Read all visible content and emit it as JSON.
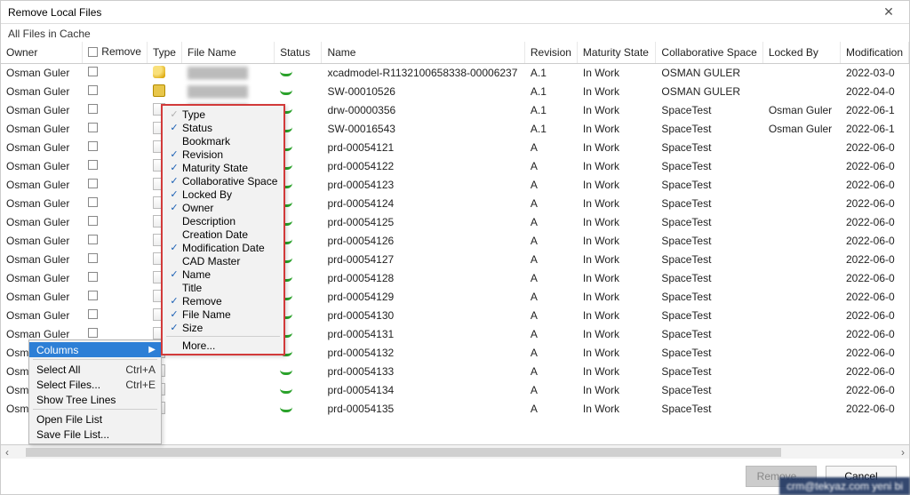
{
  "dialog": {
    "title": "Remove Local Files"
  },
  "subhead": "All Files in Cache",
  "columns": {
    "owner": "Owner",
    "remove": "Remove",
    "type": "Type",
    "filename": "File Name",
    "status": "Status",
    "name": "Name",
    "revision": "Revision",
    "maturity": "Maturity State",
    "collab": "Collaborative Space",
    "locked": "Locked By",
    "moddate": "Modification "
  },
  "rows": [
    {
      "owner": "Osman Guler",
      "type": "part",
      "filename": "████████",
      "name": "xcadmodel-R1132100658338-00006237",
      "rev": "A.1",
      "mat": "In Work",
      "collab": "OSMAN GULER",
      "locked": "",
      "mod": "2022-03-0"
    },
    {
      "owner": "Osman Guler",
      "type": "assy",
      "filename": "████████",
      "name": "SW-00010526",
      "rev": "A.1",
      "mat": "In Work",
      "collab": "OSMAN GULER",
      "locked": "",
      "mod": "2022-04-0"
    },
    {
      "owner": "Osman Guler",
      "type": "drw",
      "filename": "████████",
      "name": "drw-00000356",
      "rev": "A.1",
      "mat": "In Work",
      "collab": "SpaceTest",
      "locked": "Osman Guler",
      "mod": "2022-06-1"
    },
    {
      "owner": "Osman Guler",
      "type": "drw",
      "filename": "",
      "name": "SW-00016543",
      "rev": "A.1",
      "mat": "In Work",
      "collab": "SpaceTest",
      "locked": "Osman Guler",
      "mod": "2022-06-1"
    },
    {
      "owner": "Osman Guler",
      "type": "drw",
      "filename": "",
      "name": "prd-00054121",
      "rev": "A",
      "mat": "In Work",
      "collab": "SpaceTest",
      "locked": "",
      "mod": "2022-06-0"
    },
    {
      "owner": "Osman Guler",
      "type": "drw",
      "filename": "",
      "name": "prd-00054122",
      "rev": "A",
      "mat": "In Work",
      "collab": "SpaceTest",
      "locked": "",
      "mod": "2022-06-0"
    },
    {
      "owner": "Osman Guler",
      "type": "drw",
      "filename": "",
      "name": "prd-00054123",
      "rev": "A",
      "mat": "In Work",
      "collab": "SpaceTest",
      "locked": "",
      "mod": "2022-06-0"
    },
    {
      "owner": "Osman Guler",
      "type": "drw",
      "filename": "",
      "name": "prd-00054124",
      "rev": "A",
      "mat": "In Work",
      "collab": "SpaceTest",
      "locked": "",
      "mod": "2022-06-0"
    },
    {
      "owner": "Osman Guler",
      "type": "drw",
      "filename": "",
      "name": "prd-00054125",
      "rev": "A",
      "mat": "In Work",
      "collab": "SpaceTest",
      "locked": "",
      "mod": "2022-06-0"
    },
    {
      "owner": "Osman Guler",
      "type": "drw",
      "filename": "",
      "name": "prd-00054126",
      "rev": "A",
      "mat": "In Work",
      "collab": "SpaceTest",
      "locked": "",
      "mod": "2022-06-0"
    },
    {
      "owner": "Osman Guler",
      "type": "drw",
      "filename": "",
      "name": "prd-00054127",
      "rev": "A",
      "mat": "In Work",
      "collab": "SpaceTest",
      "locked": "",
      "mod": "2022-06-0"
    },
    {
      "owner": "Osman Guler",
      "type": "drw",
      "filename": "",
      "name": "prd-00054128",
      "rev": "A",
      "mat": "In Work",
      "collab": "SpaceTest",
      "locked": "",
      "mod": "2022-06-0"
    },
    {
      "owner": "Osman Guler",
      "type": "drw",
      "filename": "",
      "name": "prd-00054129",
      "rev": "A",
      "mat": "In Work",
      "collab": "SpaceTest",
      "locked": "",
      "mod": "2022-06-0"
    },
    {
      "owner": "Osman Guler",
      "type": "drw",
      "filename": "",
      "name": "prd-00054130",
      "rev": "A",
      "mat": "In Work",
      "collab": "SpaceTest",
      "locked": "",
      "mod": "2022-06-0"
    },
    {
      "owner": "Osman Guler",
      "type": "drw",
      "filename": "",
      "name": "prd-00054131",
      "rev": "A",
      "mat": "In Work",
      "collab": "SpaceTest",
      "locked": "",
      "mod": "2022-06-0"
    },
    {
      "owner": "Osman Guler",
      "type": "drw",
      "filename": "",
      "name": "prd-00054132",
      "rev": "A",
      "mat": "In Work",
      "collab": "SpaceTest",
      "locked": "",
      "mod": "2022-06-0"
    },
    {
      "owner": "Osman Guler",
      "type": "drw",
      "filename": "",
      "name": "prd-00054133",
      "rev": "A",
      "mat": "In Work",
      "collab": "SpaceTest",
      "locked": "",
      "mod": "2022-06-0"
    },
    {
      "owner": "Osman Guler",
      "type": "drw",
      "filename": "",
      "name": "prd-00054134",
      "rev": "A",
      "mat": "In Work",
      "collab": "SpaceTest",
      "locked": "",
      "mod": "2022-06-0"
    },
    {
      "owner": "Osman Guler",
      "type": "drw",
      "filename": "",
      "name": "prd-00054135",
      "rev": "A",
      "mat": "In Work",
      "collab": "SpaceTest",
      "locked": "",
      "mod": "2022-06-0"
    }
  ],
  "ctx": {
    "columns": "Columns",
    "selall": "Select All",
    "selall_accel": "Ctrl+A",
    "selfiles": "Select Files...",
    "selfiles_accel": "Ctrl+E",
    "treelines": "Show Tree Lines",
    "open": "Open File List",
    "save": "Save File List..."
  },
  "subm": [
    {
      "label": "Type",
      "on": true,
      "disabled": true
    },
    {
      "label": "Status",
      "on": true
    },
    {
      "label": "Bookmark",
      "on": false
    },
    {
      "label": "Revision",
      "on": true
    },
    {
      "label": "Maturity State",
      "on": true
    },
    {
      "label": "Collaborative Space",
      "on": true
    },
    {
      "label": "Locked By",
      "on": true
    },
    {
      "label": "Owner",
      "on": true
    },
    {
      "label": "Description",
      "on": false
    },
    {
      "label": "Creation Date",
      "on": false
    },
    {
      "label": "Modification Date",
      "on": true
    },
    {
      "label": "CAD Master",
      "on": false
    },
    {
      "label": "Name",
      "on": true
    },
    {
      "label": "Title",
      "on": false
    },
    {
      "label": "Remove",
      "on": true
    },
    {
      "label": "File Name",
      "on": true
    },
    {
      "label": "Size",
      "on": true
    }
  ],
  "subm_more": "More...",
  "footer": {
    "remove": "Remove...",
    "cancel": "Cancel"
  },
  "watermark": "crm@tekyaz.com yeni bi"
}
